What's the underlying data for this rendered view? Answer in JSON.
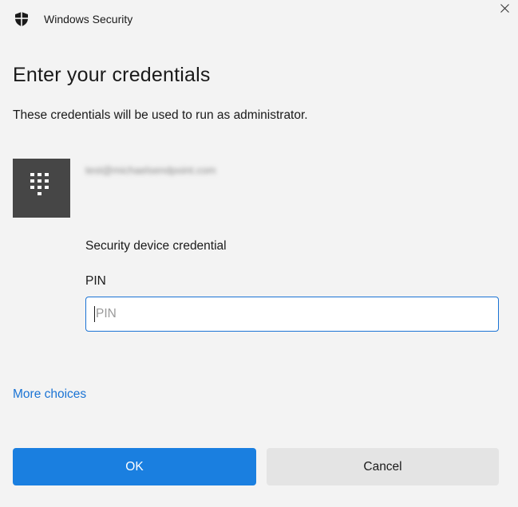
{
  "window": {
    "title": "Windows Security",
    "close_icon": "close-icon",
    "app_icon": "shield-icon"
  },
  "main": {
    "heading": "Enter your credentials",
    "subheading": "These credentials will be used to run as administrator."
  },
  "account": {
    "tile_icon": "keypad-icon",
    "email": "test@michaelsendpoint.com",
    "email_blurred": true,
    "credential_type": "Security device credential"
  },
  "pin": {
    "label": "PIN",
    "placeholder": "PIN",
    "value": ""
  },
  "links": {
    "more_choices": "More choices"
  },
  "buttons": {
    "ok": "OK",
    "cancel": "Cancel"
  },
  "colors": {
    "accent": "#1a7fe0",
    "link": "#1a73d4",
    "tile": "#464646",
    "background": "#f3f3f3"
  }
}
